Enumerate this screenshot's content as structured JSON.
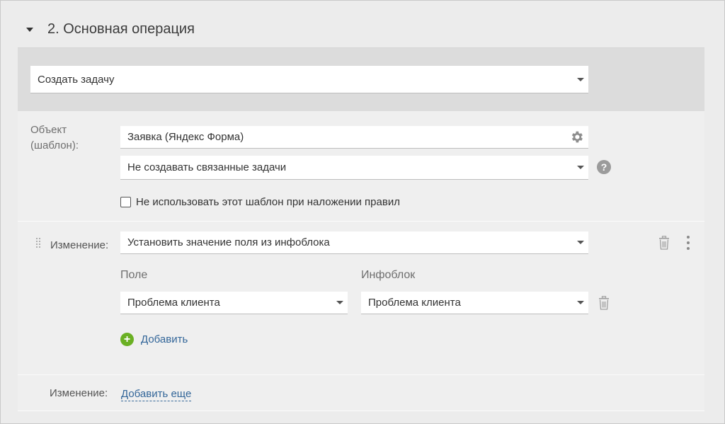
{
  "section": {
    "title": "2. Основная операция"
  },
  "operation": {
    "selected": "Создать задачу"
  },
  "object": {
    "label": "Объект (шаблон):",
    "template_value": "Заявка (Яндекс Форма)",
    "related_tasks_selected": "Не создавать связанные задачи",
    "help_symbol": "?",
    "checkbox_label": "Не использовать этот шаблон при наложении правил",
    "checkbox_checked": false
  },
  "change": {
    "label": "Изменение:",
    "action_selected": "Установить значение поля из инфоблока",
    "field_column_label": "Поле",
    "infoblock_column_label": "Инфоблок",
    "field_selected": "Проблема клиента",
    "infoblock_selected": "Проблема клиента",
    "add_label": "Добавить",
    "add_symbol": "+"
  },
  "footer": {
    "label": "Изменение:",
    "add_more_label": "Добавить еще"
  },
  "colors": {
    "link": "#336699",
    "add_green": "#6ab023",
    "band": "#dcdcdc",
    "panel": "#efefef"
  }
}
